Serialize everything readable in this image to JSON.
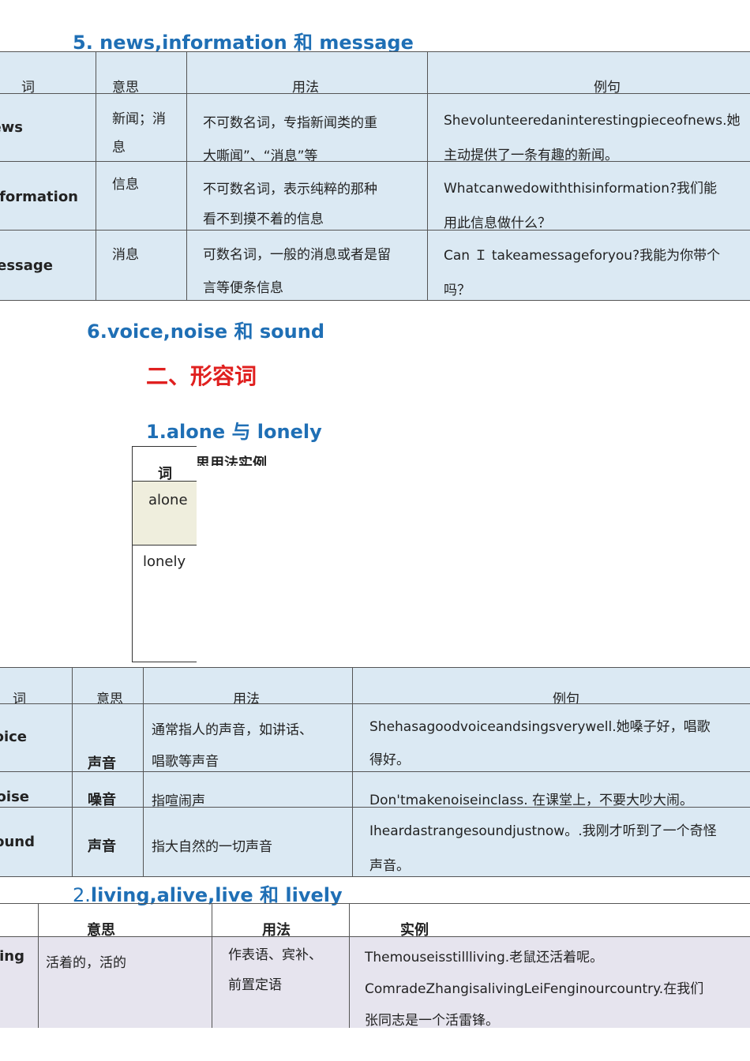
{
  "s5": {
    "heading": "5.   news,information 和 message",
    "headers": [
      "词",
      "意思",
      "用法",
      "例句"
    ],
    "rows": [
      {
        "word": "news",
        "meaning": [
          "新闻；消",
          "息"
        ],
        "usage": [
          "不可数名词，专指新闻类的重",
          "大嘶闻”、“消息”等"
        ],
        "example": [
          "Shevolunteeredaninterestingpieceofnews.她",
          "主动提供了一条有趣的新闻。"
        ]
      },
      {
        "word": "information",
        "meaning": [
          "信息"
        ],
        "usage": [
          "不可数名词，表示纯粹的那种",
          "看不到摸不着的信息"
        ],
        "example": [
          "Whatcanwedowiththisinformation?我们能",
          "用此信息做什么？"
        ]
      },
      {
        "word": "message",
        "meaning": [
          "消息"
        ],
        "usage": [
          "可数名词，一般的消息或者是留",
          "言等便条信息"
        ],
        "example": [
          "Can Ｉ takeamessageforyou?我能为你带个",
          "吗？"
        ]
      }
    ]
  },
  "s6": {
    "heading": "6.voice,noise 和 sound",
    "headers": [
      "词",
      "意思",
      "用法",
      "例句"
    ],
    "rows": [
      {
        "word": "voice",
        "meaning": "声音",
        "usage": [
          "通常指人的声音，如讲话、",
          "唱歌等声音"
        ],
        "example": [
          "Shehasagoodvoiceandsingsverywell.她嗓子好，唱歌",
          "得好。"
        ]
      },
      {
        "word": "noise",
        "meaning": "噪音",
        "usage": [
          "指喧闹声"
        ],
        "example": [
          "Don'tmakenoiseinclass. 在课堂上，不要大吵大闹。"
        ]
      },
      {
        "word": "sound",
        "meaning": "声音",
        "usage": [
          "指大自然的一切声音"
        ],
        "example": [
          "Iheardastrangesoundjustnow。.我刚才听到了一个奇怪",
          "声音。"
        ]
      }
    ]
  },
  "adj": {
    "heading": "二、形容词",
    "sub1": {
      "heading": "1.alone 与 lonely",
      "header_overlap": "思用法实例",
      "header_word": "词",
      "rows": [
        "alone",
        "lonely"
      ]
    },
    "sub2": {
      "heading_num": "2.",
      "heading_rest": "living,alive,live 和 lively",
      "headers": [
        "意思",
        "用法",
        "实例"
      ],
      "row": {
        "word": "living",
        "meaning": "活着的，活的",
        "usage": [
          "作表语、宾补、",
          "前置定语"
        ],
        "example": [
          "Themouseisstillliving.老鼠还活着呢。",
          "ComradeZhangisalivingLeiFenginourcountry.在我们",
          "张同志是一个活雷锋。"
        ]
      }
    }
  }
}
